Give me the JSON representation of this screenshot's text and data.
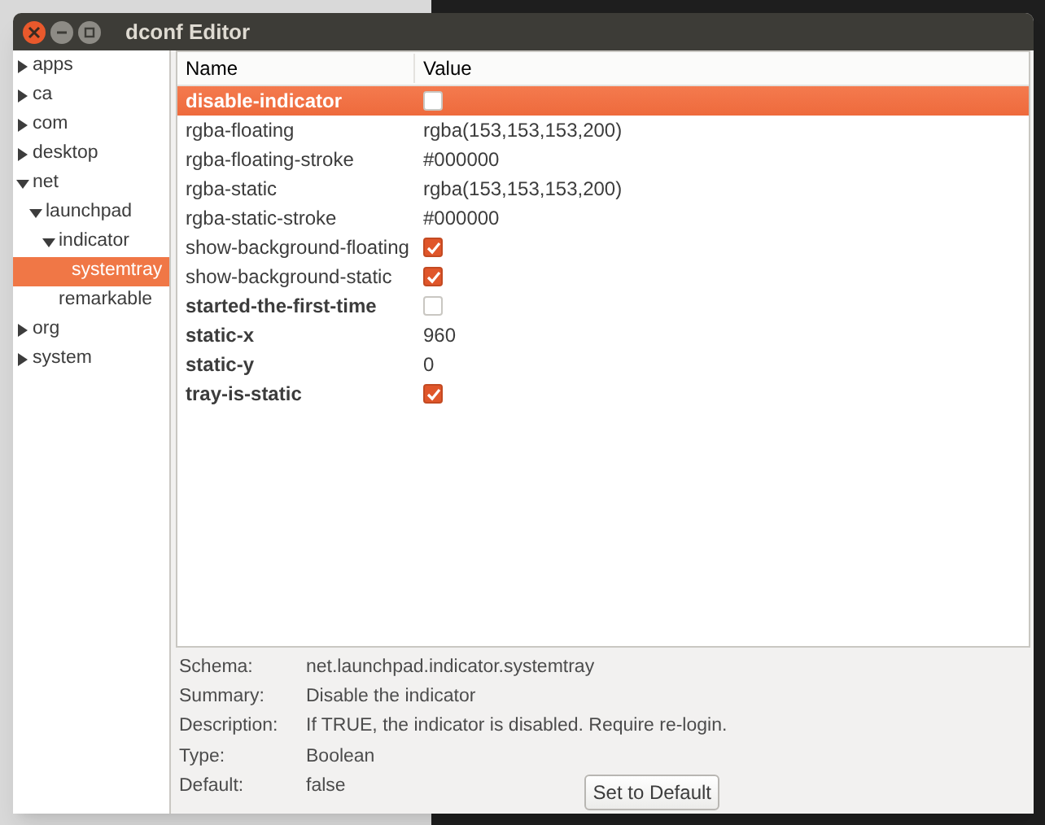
{
  "window": {
    "title": "dconf Editor"
  },
  "sidebar": {
    "items": [
      {
        "label": "apps",
        "expanded": false,
        "has_children": true,
        "selected": false
      },
      {
        "label": "ca",
        "expanded": false,
        "has_children": true,
        "selected": false
      },
      {
        "label": "com",
        "expanded": false,
        "has_children": true,
        "selected": false
      },
      {
        "label": "desktop",
        "expanded": false,
        "has_children": true,
        "selected": false
      },
      {
        "label": "net",
        "expanded": true,
        "has_children": true,
        "selected": false,
        "children": [
          {
            "label": "launchpad",
            "expanded": true,
            "has_children": true,
            "selected": false,
            "children": [
              {
                "label": "indicator",
                "expanded": true,
                "has_children": true,
                "selected": false,
                "children": [
                  {
                    "label": "systemtray",
                    "has_children": false,
                    "selected": true
                  }
                ]
              },
              {
                "label": "remarkable",
                "has_children": false,
                "selected": false
              }
            ]
          }
        ]
      },
      {
        "label": "org",
        "expanded": false,
        "has_children": true,
        "selected": false
      },
      {
        "label": "system",
        "expanded": false,
        "has_children": true,
        "selected": false
      }
    ]
  },
  "table": {
    "columns": [
      "Name",
      "Value"
    ],
    "rows": [
      {
        "name": "disable-indicator",
        "kind": "checkbox",
        "checked": false,
        "modified": true,
        "selected": true
      },
      {
        "name": "rgba-floating",
        "kind": "text",
        "value": "rgba(153,153,153,200)",
        "modified": false,
        "selected": false
      },
      {
        "name": "rgba-floating-stroke",
        "kind": "text",
        "value": "#000000",
        "modified": false,
        "selected": false
      },
      {
        "name": "rgba-static",
        "kind": "text",
        "value": "rgba(153,153,153,200)",
        "modified": false,
        "selected": false
      },
      {
        "name": "rgba-static-stroke",
        "kind": "text",
        "value": "#000000",
        "modified": false,
        "selected": false
      },
      {
        "name": "show-background-floating",
        "kind": "checkbox",
        "checked": true,
        "modified": false,
        "selected": false
      },
      {
        "name": "show-background-static",
        "kind": "checkbox",
        "checked": true,
        "modified": false,
        "selected": false
      },
      {
        "name": "started-the-first-time",
        "kind": "checkbox",
        "checked": false,
        "modified": true,
        "selected": false
      },
      {
        "name": "static-x",
        "kind": "text",
        "value": "960",
        "modified": true,
        "selected": false
      },
      {
        "name": "static-y",
        "kind": "text",
        "value": "0",
        "modified": true,
        "selected": false
      },
      {
        "name": "tray-is-static",
        "kind": "checkbox",
        "checked": true,
        "modified": true,
        "selected": false
      }
    ]
  },
  "details": [
    {
      "label": "Schema:",
      "value": "net.launchpad.indicator.systemtray"
    },
    {
      "label": "Summary:",
      "value": "Disable the indicator"
    },
    {
      "label": "Description:",
      "value": "If TRUE, the indicator is disabled. Require re-login."
    },
    {
      "label": "Type:",
      "value": "Boolean"
    },
    {
      "label": "Default:",
      "value": "false"
    }
  ],
  "buttons": [
    "Set to Default"
  ]
}
